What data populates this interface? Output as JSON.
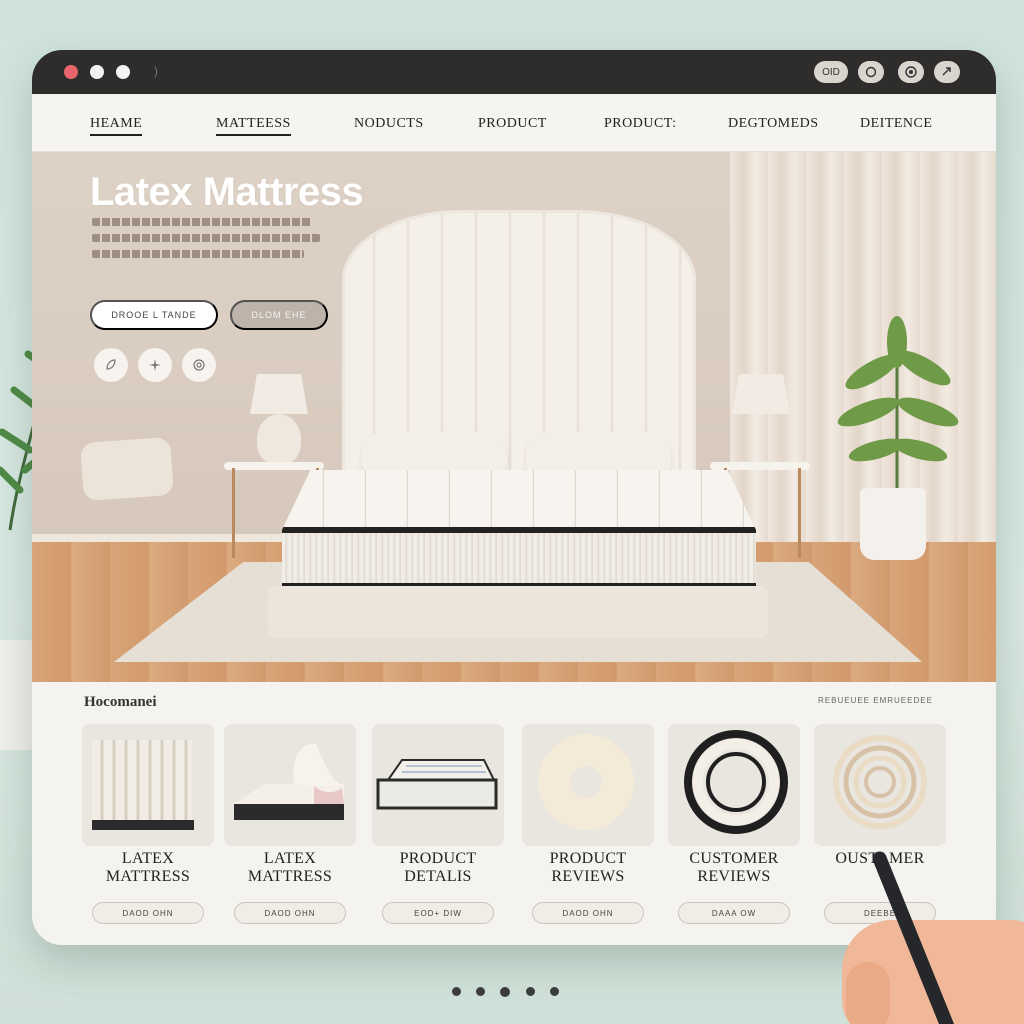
{
  "window": {
    "titlebar_buttons": [
      "OID",
      "O",
      "O",
      "O"
    ]
  },
  "nav": {
    "items": [
      "HEAME",
      "MATTEESS",
      "NODUCTS",
      "PRODUCT",
      "PRODUCT:",
      "DEGTOMEDS",
      "DEITENCE"
    ]
  },
  "hero": {
    "title": "Latex Mattress",
    "primary_button": "DROOE  L TANDE",
    "secondary_button": "DLOM  EHE",
    "icons": [
      "leaf-icon",
      "sparkle-icon",
      "swirl-icon"
    ]
  },
  "section": {
    "title": "Hocomanei",
    "link": "REBUEUEE EMRUEEDEE",
    "cards": [
      {
        "label_line1": "LATEX",
        "label_line2": "MATTRESS",
        "button": "DAOD OHN",
        "icon": "layered-foam-icon"
      },
      {
        "label_line1": "LATEX",
        "label_line2": "MATTRESS",
        "button": "DAOD OHN",
        "icon": "folded-mattress-icon"
      },
      {
        "label_line1": "PRODUCT",
        "label_line2": "DETALIS",
        "button": "EOD+ DIW",
        "icon": "mattress-icon"
      },
      {
        "label_line1": "PRODUCT",
        "label_line2": "REVIEWS",
        "button": "DAOD OHN",
        "icon": "foam-ring-icon"
      },
      {
        "label_line1": "CUSTOMER",
        "label_line2": "REVIEWS",
        "button": "DAAA OW",
        "icon": "black-ring-icon"
      },
      {
        "label_line1": "OUSTAMER",
        "label_line2": "",
        "button": "DEEBE",
        "icon": "spiral-icon"
      }
    ]
  },
  "pager": {
    "count": 5,
    "active_index": 2
  },
  "colors": {
    "titlebar": "#2f2c2c",
    "accent_red": "#e8656b",
    "background": "#cfe3dc"
  }
}
